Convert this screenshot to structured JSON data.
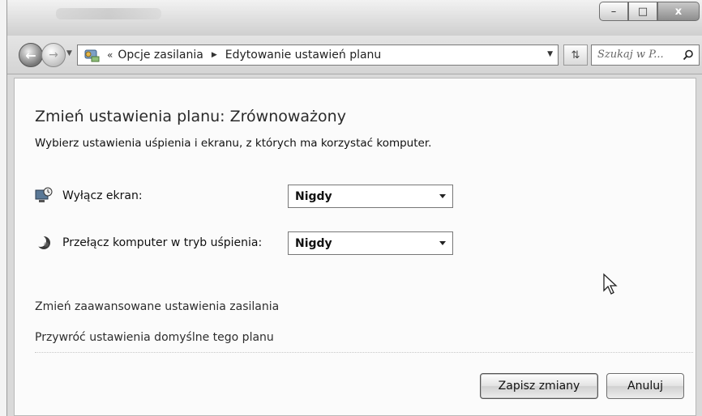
{
  "window": {
    "controls": {
      "minimize": "–",
      "maximize": "□",
      "close": "x"
    }
  },
  "navigation": {
    "back_icon": "arrow-left-icon",
    "forward_icon": "arrow-right-icon",
    "breadcrumb_overflow": "«",
    "breadcrumbs": [
      "Opcje zasilania",
      "Edytowanie ustawień planu"
    ],
    "refresh_icon": "refresh-icon",
    "search_placeholder": "Szukaj w P...",
    "search_icon": "search-icon"
  },
  "page": {
    "title": "Zmień ustawienia planu: Zrównoważony",
    "subtitle": "Wybierz ustawienia uśpienia i ekranu, z których ma korzystać komputer.",
    "settings": [
      {
        "label": "Wyłącz ekran:",
        "value": "Nigdy",
        "icon": "monitor-clock-icon"
      },
      {
        "label": "Przełącz komputer w tryb uśpienia:",
        "value": "Nigdy",
        "icon": "moon-icon"
      }
    ],
    "links": {
      "advanced": "Zmień zaawansowane ustawienia zasilania",
      "restore": "Przywróć ustawienia domyślne tego planu"
    },
    "buttons": {
      "save": "Zapisz zmiany",
      "cancel": "Anuluj"
    }
  }
}
